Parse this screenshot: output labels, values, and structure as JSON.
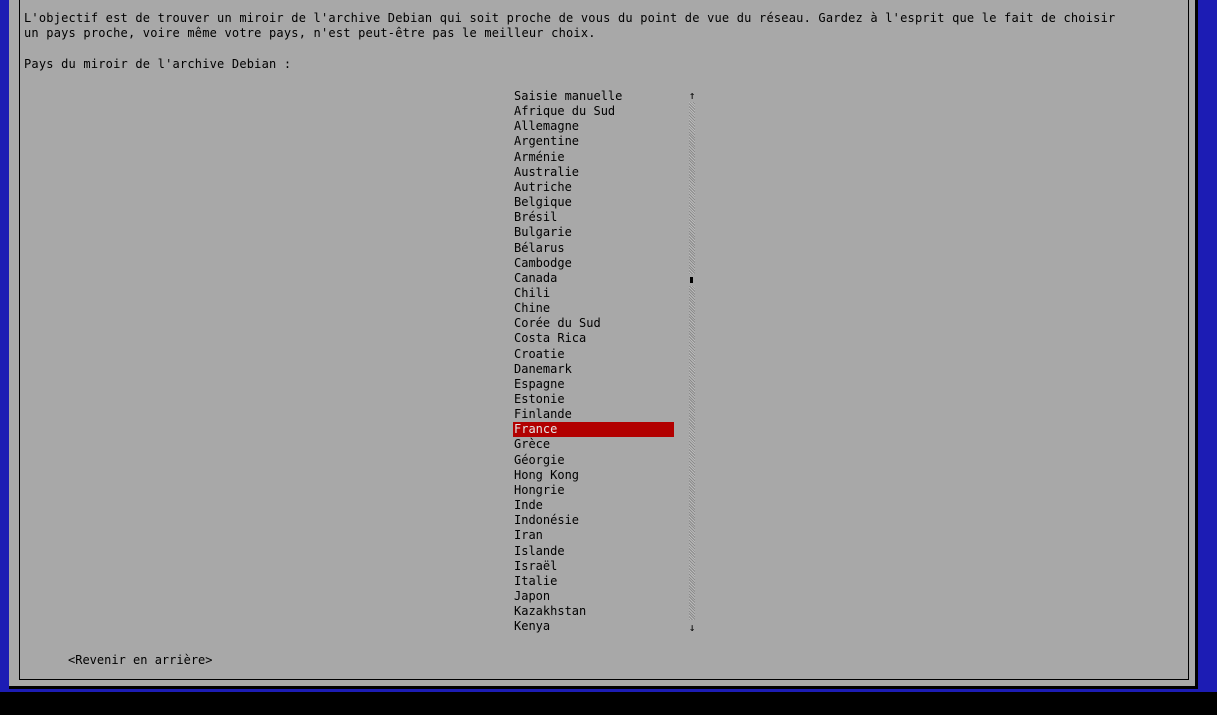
{
  "description": {
    "line1": "L'objectif est de trouver un miroir de l'archive Debian qui soit proche de vous du point de vue du réseau. Gardez à l'esprit que le fait de choisir",
    "line2": "un pays proche, voire même votre pays, n'est peut-être pas le meilleur choix."
  },
  "question": "Pays du miroir de l'archive Debian :",
  "countries": [
    "Saisie manuelle",
    "Afrique du Sud",
    "Allemagne",
    "Argentine",
    "Arménie",
    "Australie",
    "Autriche",
    "Belgique",
    "Brésil",
    "Bulgarie",
    "Bélarus",
    "Cambodge",
    "Canada",
    "Chili",
    "Chine",
    "Corée du Sud",
    "Costa Rica",
    "Croatie",
    "Danemark",
    "Espagne",
    "Estonie",
    "Finlande",
    "France",
    "Grèce",
    "Géorgie",
    "Hong Kong",
    "Hongrie",
    "Inde",
    "Indonésie",
    "Iran",
    "Islande",
    "Israël",
    "Italie",
    "Japon",
    "Kazakhstan",
    "Kenya"
  ],
  "selected_country": "France",
  "scrollbar": {
    "up_arrow": "↑",
    "down_arrow": "↓"
  },
  "back_button_label": "<Revenir en arrière>",
  "colors": {
    "background_blue": "#1c1cb4",
    "dialog_gray": "#a8a8a8",
    "selection_red": "#b20000"
  }
}
